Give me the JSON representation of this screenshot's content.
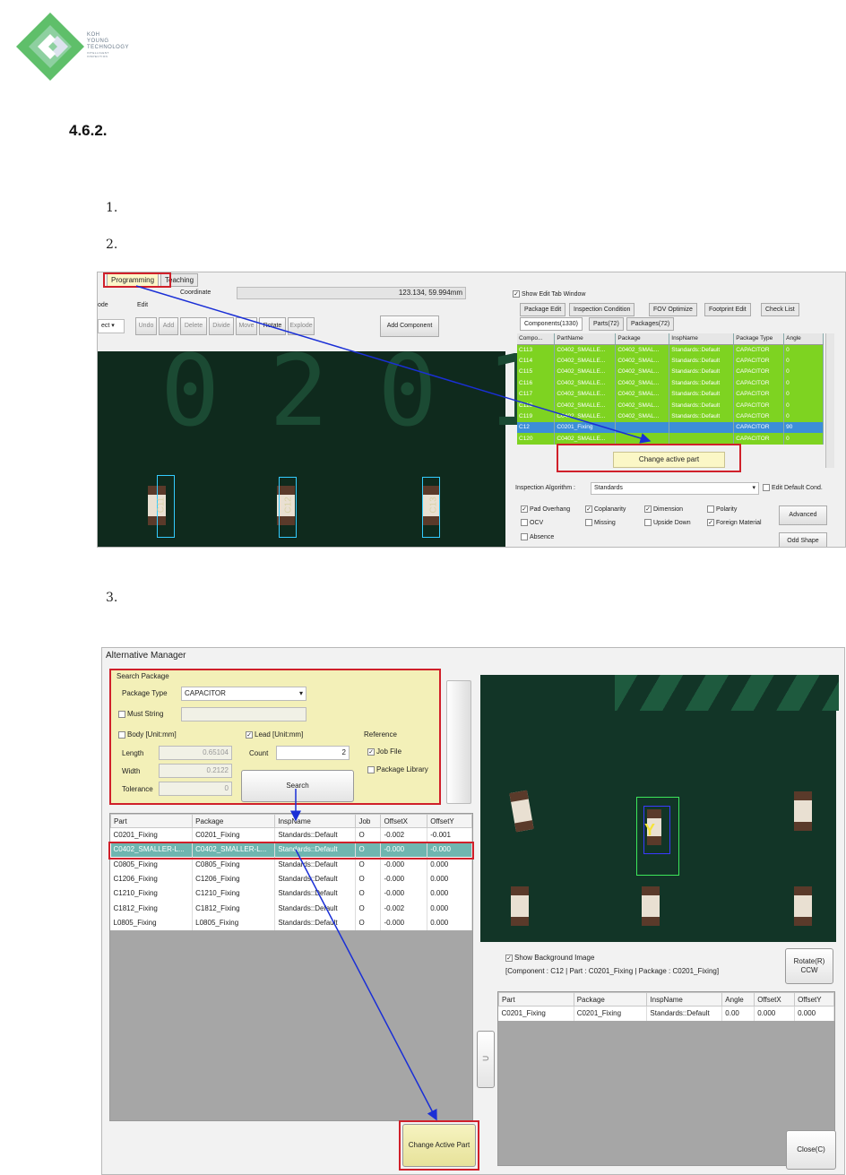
{
  "header": {
    "logo_text": [
      "KOH",
      "YOUNG",
      "TECHNOLOGY"
    ],
    "logo_tagline": [
      "INTELLIGENT",
      "INSPECTION"
    ],
    "section_number": "4.6.2.",
    "steps": [
      "1.",
      "2.",
      "3."
    ]
  },
  "shot1": {
    "tabs": {
      "programming": "Programming",
      "teaching": "Teaching"
    },
    "coordinate_label": "Coordinate",
    "coordinate_value": "123.134, 59.994mm",
    "mode_label": "ode",
    "edit_label": "Edit",
    "mode_value": "ect",
    "edit_buttons": [
      "Undo",
      "Add",
      "Delete",
      "Divide",
      "Move",
      "Rotate",
      "Explode"
    ],
    "add_component": "Add Component",
    "show_edit_tab": "Show Edit Tab Window",
    "edit_tabs": [
      "Package Edit",
      "Inspection Condition",
      "FOV Optimize",
      "Footprint Edit",
      "Check List"
    ],
    "sub_tabs": [
      "Components(1330)",
      "Parts(72)",
      "Packages(72)"
    ],
    "columns": [
      "Compo...",
      "PartName",
      "Package",
      "InspName",
      "Package Type",
      "Angle"
    ],
    "rows": [
      [
        "C113",
        "C0402_SMALLE...",
        "C0402_SMAL...",
        "Standards::Default",
        "CAPACITOR",
        "0"
      ],
      [
        "C114",
        "C0402_SMALLE...",
        "C0402_SMAL...",
        "Standards::Default",
        "CAPACITOR",
        "0"
      ],
      [
        "C115",
        "C0402_SMALLE...",
        "C0402_SMAL...",
        "Standards::Default",
        "CAPACITOR",
        "0"
      ],
      [
        "C116",
        "C0402_SMALLE...",
        "C0402_SMAL...",
        "Standards::Default",
        "CAPACITOR",
        "0"
      ],
      [
        "C117",
        "C0402_SMALLE...",
        "C0402_SMAL...",
        "Standards::Default",
        "CAPACITOR",
        "0"
      ],
      [
        "C118",
        "C0402_SMALLE...",
        "C0402_SMAL...",
        "Standards::Default",
        "CAPACITOR",
        "0"
      ],
      [
        "C119",
        "C0402_SMALLE...",
        "C0402_SMAL...",
        "Standards::Default",
        "CAPACITOR",
        "0"
      ],
      [
        "C12",
        "C0201_Fixing",
        "",
        "",
        "CAPACITOR",
        "90"
      ],
      [
        "C120",
        "C0402_SMALLE...",
        "",
        "",
        "CAPACITOR",
        "0"
      ]
    ],
    "context_menu": "Change active part",
    "insp_algorithm_label": "Inspection Algorithm :",
    "insp_algorithm_value": "Standards",
    "edit_default_cond": "Edit Default Cond.",
    "checks": [
      {
        "label": "Pad Overhang",
        "on": true
      },
      {
        "label": "Coplanarity",
        "on": true
      },
      {
        "label": "Dimension",
        "on": true
      },
      {
        "label": "Polarity",
        "on": false
      },
      {
        "label": "OCV",
        "on": false
      },
      {
        "label": "Missing",
        "on": false
      },
      {
        "label": "Upside Down",
        "on": false
      },
      {
        "label": "Foreign Material",
        "on": true
      },
      {
        "label": "Absence",
        "on": false
      }
    ],
    "advanced": "Advanced",
    "odd_shape": "Odd Shape",
    "chip_labels": [
      "C11",
      "C12",
      "C13"
    ],
    "pcb_digits": "0201"
  },
  "shot2": {
    "title": "Alternative Manager",
    "search_package": "Search Package",
    "package_type_label": "Package Type",
    "package_type_value": "CAPACITOR",
    "must_string": "Must String",
    "body": "Body [Unit:mm]",
    "lead": "Lead [Unit:mm]",
    "reference": "Reference",
    "length_label": "Length",
    "length_value": "0.65104",
    "width_label": "Width",
    "width_value": "0.2122",
    "tolerance_label": "Tolerance",
    "tolerance_value": "0",
    "count_label": "Count",
    "count_value": "2",
    "job_file": "Job File",
    "package_library": "Package Library",
    "search": "Search",
    "columns": [
      "Part",
      "Package",
      "InspName",
      "Job",
      "OffsetX",
      "OffsetY"
    ],
    "rows": [
      [
        "C0201_Fixing",
        "C0201_Fixing",
        "Standards::Default",
        "O",
        "-0.002",
        "-0.001"
      ],
      [
        "C0402_SMALLER-L...",
        "C0402_SMALLER-L...",
        "Standards::Default",
        "O",
        "-0.000",
        "-0.000"
      ],
      [
        "C0805_Fixing",
        "C0805_Fixing",
        "Standards::Default",
        "O",
        "-0.000",
        "0.000"
      ],
      [
        "C1206_Fixing",
        "C1206_Fixing",
        "Standards::Default",
        "O",
        "-0.000",
        "0.000"
      ],
      [
        "C1210_Fixing",
        "C1210_Fixing",
        "Standards::Default",
        "O",
        "-0.000",
        "0.000"
      ],
      [
        "C1812_Fixing",
        "C1812_Fixing",
        "Standards::Default",
        "O",
        "-0.002",
        "0.000"
      ],
      [
        "L0805_Fixing",
        "L0805_Fixing",
        "Standards::Default",
        "O",
        "-0.000",
        "0.000"
      ]
    ],
    "change_active_part": "Change Active Part",
    "show_background": "Show Background Image",
    "component_info": "[Component : C12 | Part : C0201_Fixing | Package : C0201_Fixing]",
    "rotate_line1": "Rotate(R)",
    "rotate_line2": "CCW",
    "bottom_columns": [
      "Part",
      "Package",
      "InspName",
      "Angle",
      "OffsetX",
      "OffsetY"
    ],
    "bottom_rows": [
      [
        "C0201_Fixing",
        "C0201_Fixing",
        "Standards::Default",
        "0.00",
        "0.000",
        "0.000"
      ]
    ],
    "undo_glyph": "⊃",
    "close": "Close(C)"
  },
  "colors": {
    "accent_red": "#d0202a",
    "arrow_blue": "#1a2fd6",
    "grid_green": "#7ed321",
    "grid_select": "#3c8ed8",
    "panel_yellow": "#f3f0b8",
    "logo_green": "#66bb6a"
  }
}
